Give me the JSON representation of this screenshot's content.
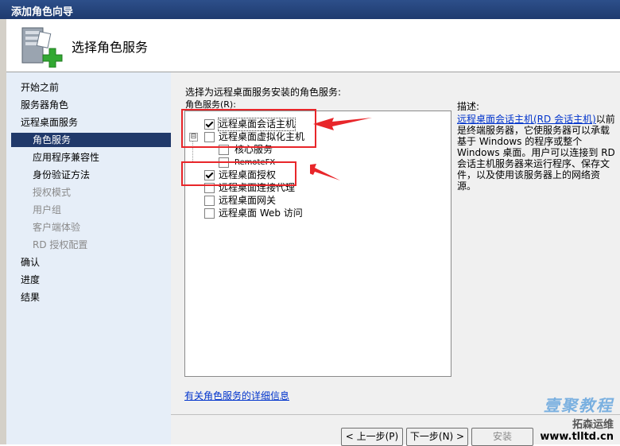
{
  "window": {
    "title": "添加角色向导"
  },
  "header": {
    "title": "选择角色服务"
  },
  "nav": {
    "items": [
      {
        "label": "开始之前",
        "state": "normal"
      },
      {
        "label": "服务器角色",
        "state": "normal"
      },
      {
        "label": "远程桌面服务",
        "state": "normal"
      },
      {
        "label": "角色服务",
        "state": "selected"
      },
      {
        "label": "应用程序兼容性",
        "state": "normal"
      },
      {
        "label": "身份验证方法",
        "state": "normal"
      },
      {
        "label": "授权模式",
        "state": "disabled"
      },
      {
        "label": "用户组",
        "state": "disabled"
      },
      {
        "label": "客户端体验",
        "state": "disabled"
      },
      {
        "label": "RD 授权配置",
        "state": "disabled"
      },
      {
        "label": "确认",
        "state": "normal"
      },
      {
        "label": "进度",
        "state": "normal"
      },
      {
        "label": "结果",
        "state": "normal"
      }
    ]
  },
  "content": {
    "instruction": "选择为远程桌面服务安装的角色服务:",
    "role_services_label": "角色服务(R):",
    "description_label": "描述:",
    "description_link": "远程桌面会话主机(RD 会话主机)",
    "description_text": "以前是终端服务器，它使服务器可以承载基于 Windows 的程序或整个 Windows 桌面。用户可以连接到 RD 会话主机服务器来运行程序、保存文件，以及使用该服务器上的网络资源。",
    "more_info_link": "有关角色服务的详细信息",
    "services": [
      {
        "label": "远程桌面会话主机",
        "checked": true,
        "level": 0
      },
      {
        "label": "远程桌面虚拟化主机",
        "checked": false,
        "level": 0,
        "expander": "⊟"
      },
      {
        "label": "核心服务",
        "checked": false,
        "level": 1
      },
      {
        "label": "RemoteFX",
        "checked": false,
        "level": 1
      },
      {
        "label": "远程桌面授权",
        "checked": true,
        "level": 0
      },
      {
        "label": "远程桌面连接代理",
        "checked": false,
        "level": 0
      },
      {
        "label": "远程桌面网关",
        "checked": false,
        "level": 0
      },
      {
        "label": "远程桌面 Web 访问",
        "checked": false,
        "level": 0
      }
    ]
  },
  "buttons": {
    "back": "< 上一步(P)",
    "next": "下一步(N) >",
    "install": "安装"
  },
  "watermark": {
    "line1": "壹聚教程",
    "line2": "拓森运维",
    "line3": "www.tlltd.cn"
  },
  "colors": {
    "annotation": "#e8262a",
    "nav_selected": "#20396a",
    "link": "#0033cc"
  }
}
